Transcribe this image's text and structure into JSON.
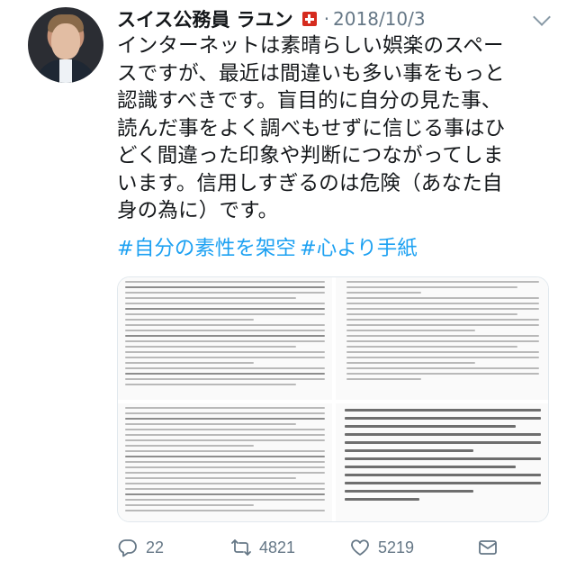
{
  "author": {
    "name": "スイス公務員 ラユン",
    "flag": "🇨🇭",
    "separator": "·",
    "date": "2018/10/3"
  },
  "tweet": {
    "lines": [
      "インターネットは素晴らしい娯楽のスペー",
      "スですが、最近は間違いも多い事をもっと",
      "認識すべきです。盲目的に自分の見た事、",
      "読んだ事をよく調べもせずに信じる事はひ",
      "どく間違った印象や判断につながってしま",
      "います。信用しすぎるのは危険（あなた自",
      "身の為に）です。"
    ],
    "hashtags": [
      "#自分の素性を架空",
      "#心より手紙"
    ]
  },
  "media": {
    "image_count": 4
  },
  "actions": {
    "reply_count": "22",
    "retweet_count": "4821",
    "like_count": "5219"
  },
  "icons": {
    "reply": "reply-icon",
    "retweet": "retweet-icon",
    "like": "heart-icon",
    "dm": "mail-icon",
    "menu": "chevron-down-icon"
  },
  "colors": {
    "link": "#1da1f2",
    "meta": "#657786",
    "text": "#14171a",
    "flag_red": "#d52b1e"
  }
}
